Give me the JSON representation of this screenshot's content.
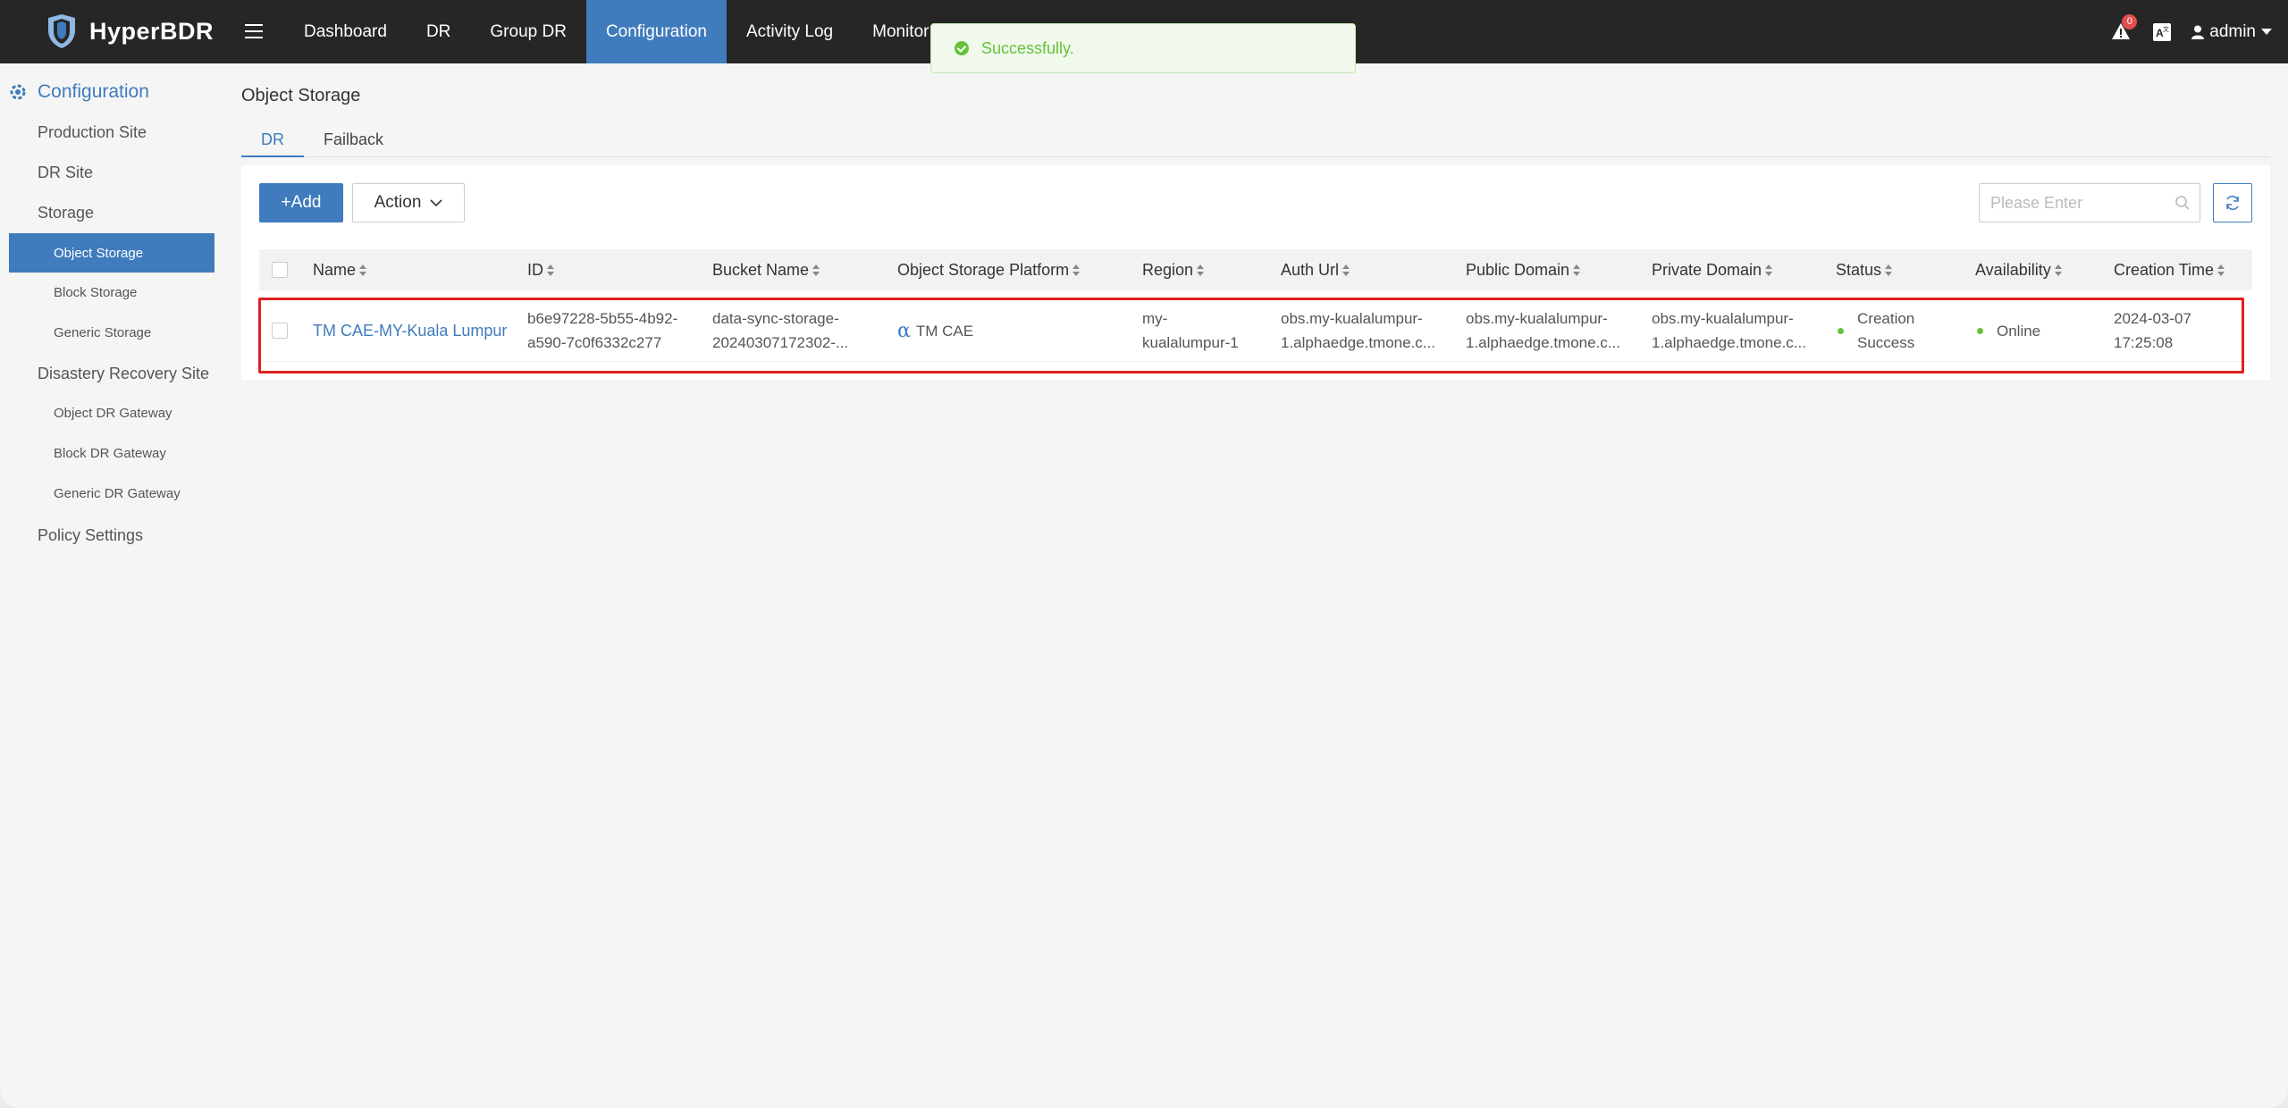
{
  "app": {
    "name": "HyperBDR"
  },
  "nav": {
    "items": [
      "Dashboard",
      "DR",
      "Group DR",
      "Configuration",
      "Activity Log",
      "Monitor & Alert"
    ],
    "active": "Configuration"
  },
  "topbar": {
    "alert_count": "0",
    "user": "admin"
  },
  "toast": {
    "message": "Successfully."
  },
  "sidebar": {
    "heading": "Configuration",
    "production_site": "Production Site",
    "dr_site": "DR Site",
    "storage": "Storage",
    "object_storage": "Object Storage",
    "block_storage": "Block Storage",
    "generic_storage": "Generic Storage",
    "disaster_recovery_site": "Disastery Recovery Site",
    "object_dr_gateway": "Object DR Gateway",
    "block_dr_gateway": "Block DR Gateway",
    "generic_dr_gateway": "Generic DR Gateway",
    "policy_settings": "Policy Settings"
  },
  "page": {
    "title": "Object Storage",
    "tabs": [
      "DR",
      "Failback"
    ],
    "add_label": "+Add",
    "action_label": "Action",
    "search_placeholder": "Please Enter"
  },
  "table": {
    "columns": [
      "Name",
      "ID",
      "Bucket Name",
      "Object Storage Platform",
      "Region",
      "Auth Url",
      "Public Domain",
      "Private Domain",
      "Status",
      "Availability",
      "Creation Time"
    ],
    "rows": [
      {
        "name": "TM CAE-MY-Kuala Lumpur",
        "id_line1": "b6e97228-5b55-4b92-",
        "id_line2": "a590-7c0f6332c277",
        "bucket_line1": "data-sync-storage-",
        "bucket_line2": "20240307172302-...",
        "platform": "TM CAE",
        "region_line1": "my-",
        "region_line2": "kualalumpur-1",
        "auth_line1": "obs.my-kualalumpur-",
        "auth_line2": "1.alphaedge.tmone.c...",
        "public_line1": "obs.my-kualalumpur-",
        "public_line2": "1.alphaedge.tmone.c...",
        "private_line1": "obs.my-kualalumpur-",
        "private_line2": "1.alphaedge.tmone.c...",
        "status_line1": "Creation",
        "status_line2": "Success",
        "availability": "Online",
        "time_line1": "2024-03-07",
        "time_line2": "17:25:08"
      }
    ]
  },
  "colors": {
    "accent": "#3f7bbd",
    "topbar": "#262626",
    "success": "#67c23a",
    "highlight": "#e02020"
  }
}
